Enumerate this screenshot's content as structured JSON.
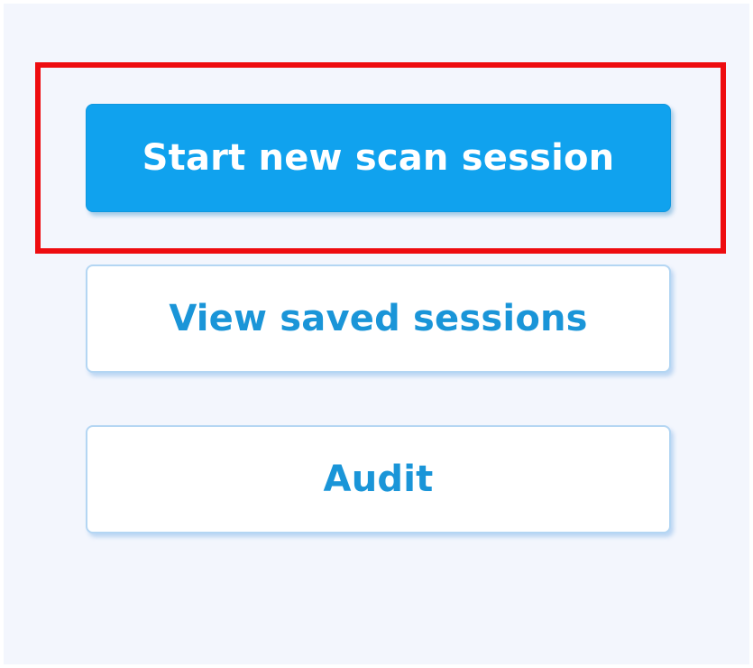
{
  "menu": {
    "start_label": "Start new scan session",
    "view_label": "View saved sessions",
    "audit_label": "Audit"
  },
  "colors": {
    "primary": "#10a2ee",
    "secondary_text": "#1a95d8",
    "highlight": "#ee0c10",
    "background": "#f3f6fd"
  }
}
